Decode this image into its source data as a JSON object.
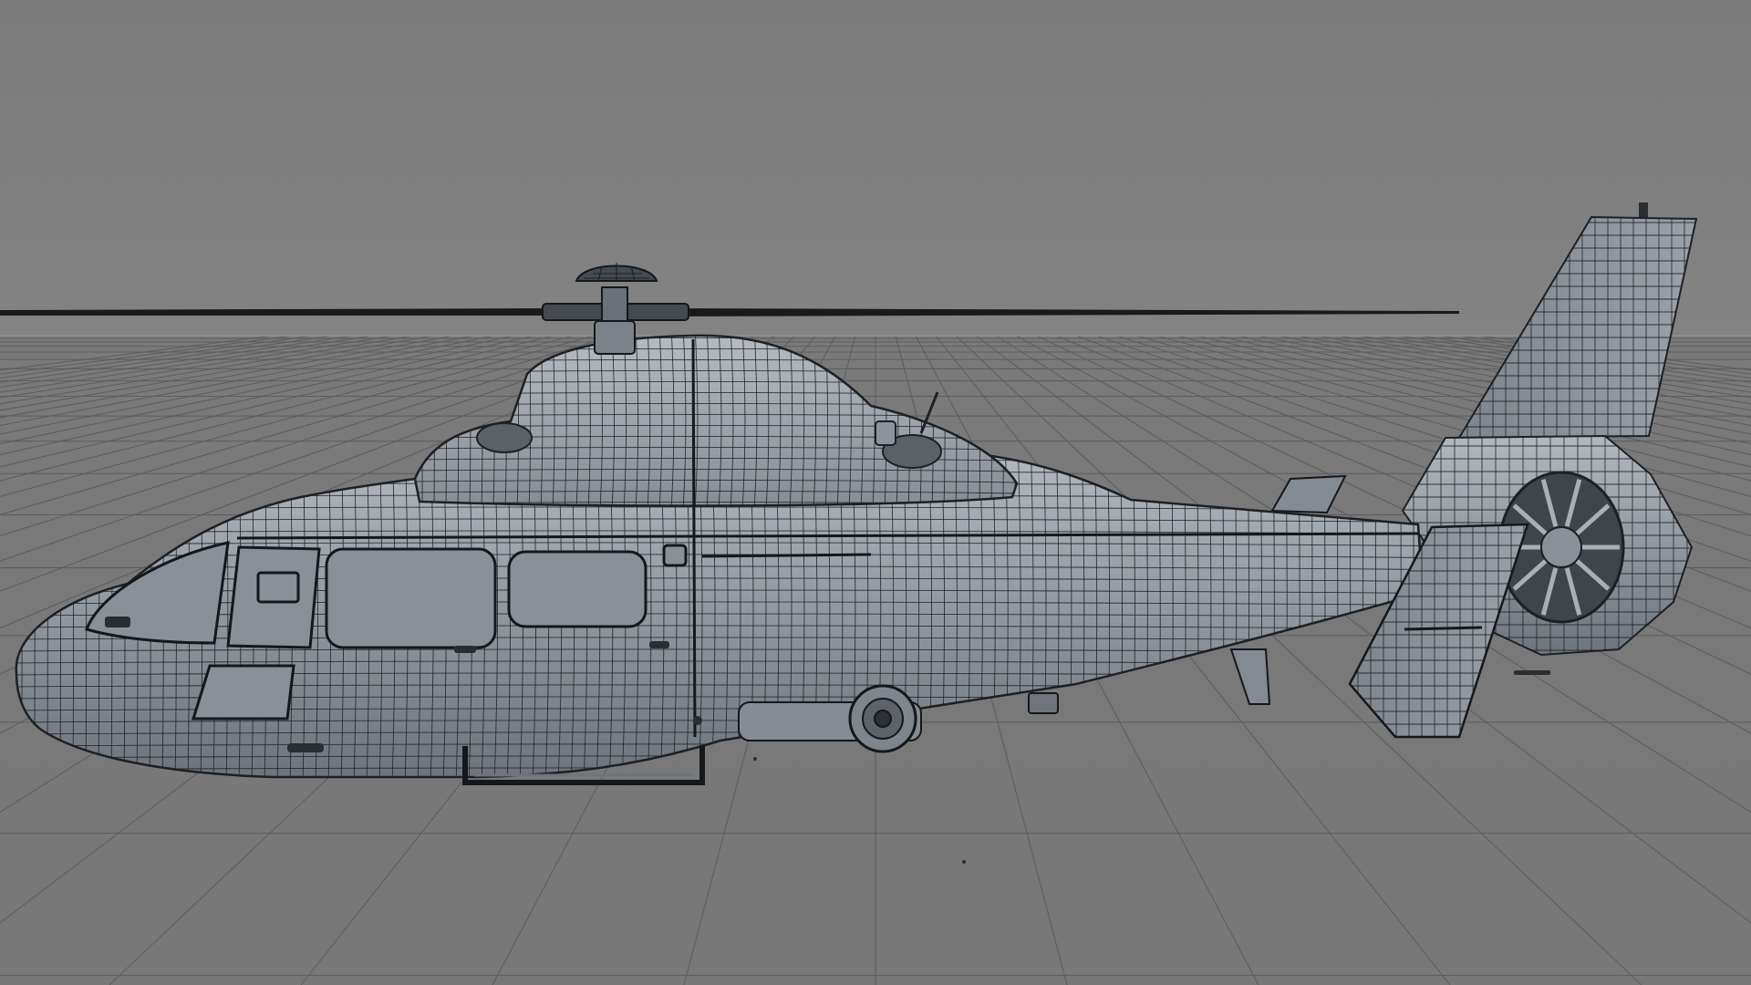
{
  "viewport": {
    "background_color": "#7d7d7d",
    "grid_color": "#5c5c5c",
    "horizon_color": "#8a8a8a"
  },
  "model": {
    "name": "helicopter",
    "display_mode": "shaded-wireframe",
    "surface_color": "#8f959c",
    "surface_light_color": "#a7adb3",
    "surface_dark_color": "#6c7278",
    "wire_color": "#1d2024",
    "rotor_color": "#1a1a1a"
  }
}
